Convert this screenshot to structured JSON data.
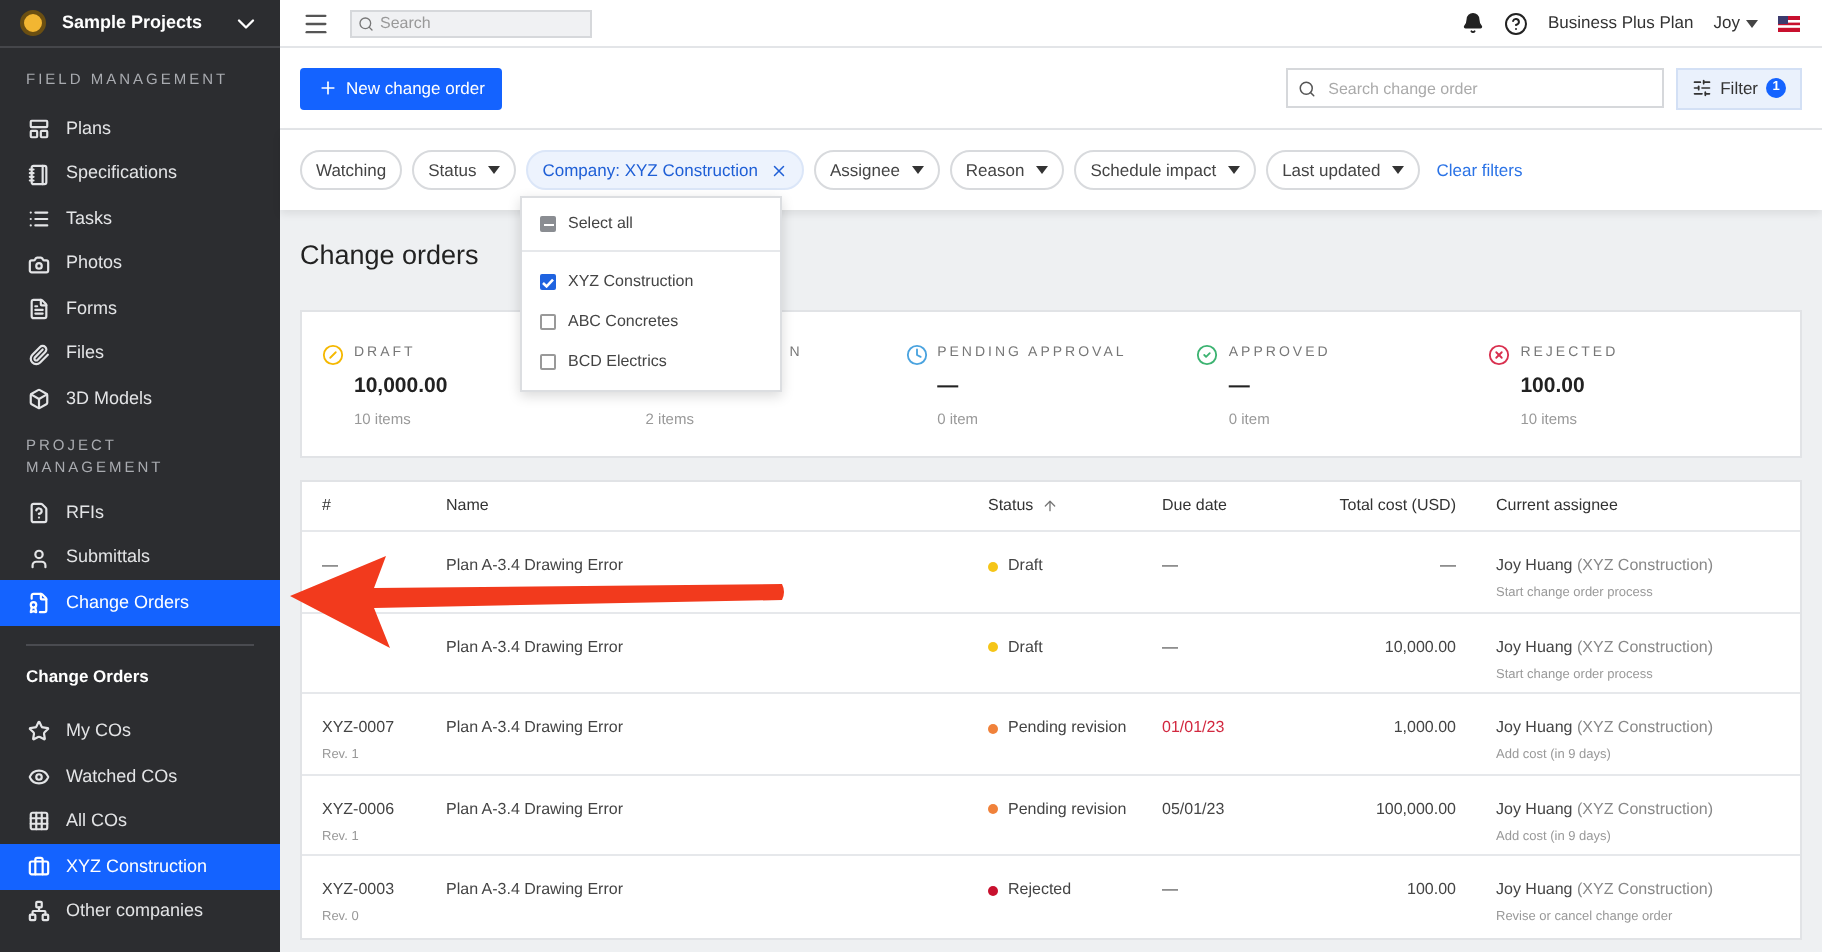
{
  "sidebar": {
    "project": "Sample Projects",
    "sections": [
      {
        "title": "FIELD MANAGEMENT",
        "items": [
          {
            "label": "Plans",
            "selected": false
          },
          {
            "label": "Specifications",
            "selected": false
          },
          {
            "label": "Tasks",
            "selected": false
          },
          {
            "label": "Photos",
            "selected": false
          },
          {
            "label": "Forms",
            "selected": false
          },
          {
            "label": "Files",
            "selected": false
          },
          {
            "label": "3D Models",
            "selected": false
          }
        ]
      },
      {
        "title": "PROJECT MANAGEMENT",
        "items": [
          {
            "label": "RFIs",
            "selected": false
          },
          {
            "label": "Submittals",
            "selected": false
          },
          {
            "label": "Change Orders",
            "selected": true
          }
        ]
      }
    ],
    "sub_title": "Change Orders",
    "sub_items": [
      {
        "label": "My COs",
        "selected": false
      },
      {
        "label": "Watched COs",
        "selected": false
      },
      {
        "label": "All COs",
        "selected": false
      },
      {
        "label": "XYZ Construction",
        "selected": true
      },
      {
        "label": "Other companies",
        "selected": false
      }
    ]
  },
  "topbar": {
    "search_placeholder": "Search",
    "plan": "Business Plus Plan",
    "user": "Joy"
  },
  "toolbar": {
    "new_button": "New change order",
    "search_placeholder": "Search change order",
    "filter_button": "Filter",
    "filter_count": "1"
  },
  "filters": [
    {
      "label": "Watching",
      "kind": "plain",
      "active": false
    },
    {
      "label": "Status",
      "kind": "dropdown",
      "active": false
    },
    {
      "label": "Company: XYZ Construction",
      "kind": "removable",
      "active": true
    },
    {
      "label": "Assignee",
      "kind": "dropdown",
      "active": false
    },
    {
      "label": "Reason",
      "kind": "dropdown",
      "active": false
    },
    {
      "label": "Schedule impact",
      "kind": "dropdown",
      "active": false
    },
    {
      "label": "Last updated",
      "kind": "dropdown",
      "active": false
    }
  ],
  "clear_filters": "Clear filters",
  "dropdown": {
    "select_all": {
      "label": "Select all",
      "indeterminate": true
    },
    "options": [
      {
        "label": "XYZ Construction",
        "checked": true
      },
      {
        "label": "ABC Concretes",
        "checked": false
      },
      {
        "label": "BCD Electrics",
        "checked": false
      }
    ]
  },
  "title": "Change orders",
  "summary": [
    {
      "kind": "draft",
      "label": "DRAFT",
      "value": "10,000.00",
      "count": "10 items"
    },
    {
      "kind": "hidden",
      "label": "N",
      "count": "2 items"
    },
    {
      "kind": "pending",
      "label": "PENDING APPROVAL",
      "value": "—",
      "count": "0 item"
    },
    {
      "kind": "approved",
      "label": "APPROVED",
      "value": "—",
      "count": "0 item"
    },
    {
      "kind": "rejected",
      "label": "REJECTED",
      "value": "100.00",
      "count": "10 items"
    }
  ],
  "table": {
    "columns": [
      {
        "label": "#",
        "sorted": false
      },
      {
        "label": "Name",
        "sorted": false
      },
      {
        "label": "Status",
        "sorted": true
      },
      {
        "label": "Due date",
        "sorted": false
      },
      {
        "label": "Total cost (USD)",
        "sorted": false
      },
      {
        "label": "Current assignee",
        "sorted": false
      }
    ],
    "rows": [
      {
        "number": "—",
        "name": "Plan A-3.4 Drawing Error",
        "status": "Draft",
        "color": "#f5c518",
        "due": "—",
        "overdue": false,
        "cost": "—",
        "assignee": "Joy Huang",
        "company": "(XYZ Construction)",
        "action": "Start change order process"
      },
      {
        "name": "Plan A-3.4 Drawing Error",
        "status": "Draft",
        "color": "#f5c518",
        "due": "—",
        "overdue": false,
        "cost": "10,000.00",
        "assignee": "Joy Huang",
        "company": "(XYZ Construction)",
        "action": "Start change order process"
      },
      {
        "number": "XYZ-0007",
        "rev": "Rev. 1",
        "name": "Plan A-3.4 Drawing Error",
        "status": "Pending revision",
        "color": "#f0813a",
        "due": "01/01/23",
        "overdue": true,
        "cost": "1,000.00",
        "assignee": "Joy Huang",
        "company": "(XYZ Construction)",
        "action": "Add cost (in 9 days)"
      },
      {
        "number": "XYZ-0006",
        "rev": "Rev. 1",
        "name": "Plan A-3.4 Drawing Error",
        "status": "Pending revision",
        "color": "#f0813a",
        "due": "05/01/23",
        "overdue": false,
        "cost": "100,000.00",
        "assignee": "Joy Huang",
        "company": "(XYZ Construction)",
        "action": "Add cost (in 9 days)"
      },
      {
        "number": "XYZ-0003",
        "rev": "Rev. 0",
        "name": "Plan A-3.4 Drawing Error",
        "status": "Rejected",
        "color": "#c8102e",
        "due": "—",
        "overdue": false,
        "cost": "100.00",
        "assignee": "Joy Huang",
        "company": "(XYZ Construction)",
        "action": "Revise or cancel change order"
      }
    ]
  }
}
